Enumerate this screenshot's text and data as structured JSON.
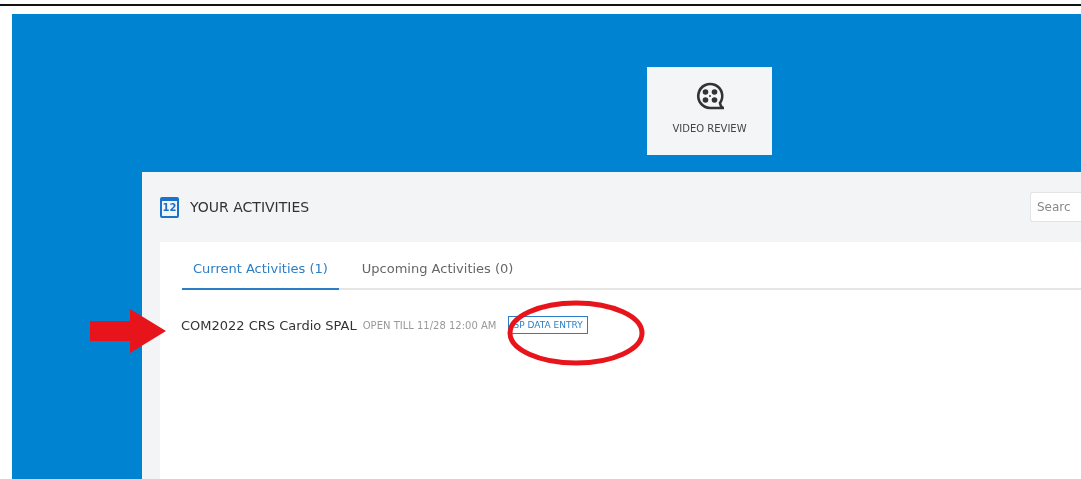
{
  "tiles": [
    {
      "label": "VIDEO REVIEW"
    }
  ],
  "activities": {
    "title": "YOUR ACTIVITIES",
    "calendar_day": "12",
    "search": {
      "placeholder": "Searc"
    },
    "tabs": [
      {
        "label": "Current Activities (1)",
        "selected": true
      },
      {
        "label": "Upcoming Activities (0)",
        "selected": false
      }
    ],
    "items": [
      {
        "name": "COM2022 CRS Cardio SPAL",
        "availability": "OPEN TILL 11/28 12:00 AM",
        "tag": "SP DATA ENTRY"
      }
    ]
  },
  "annotations": [
    {
      "kind": "arrow"
    },
    {
      "kind": "ellipse"
    }
  ]
}
